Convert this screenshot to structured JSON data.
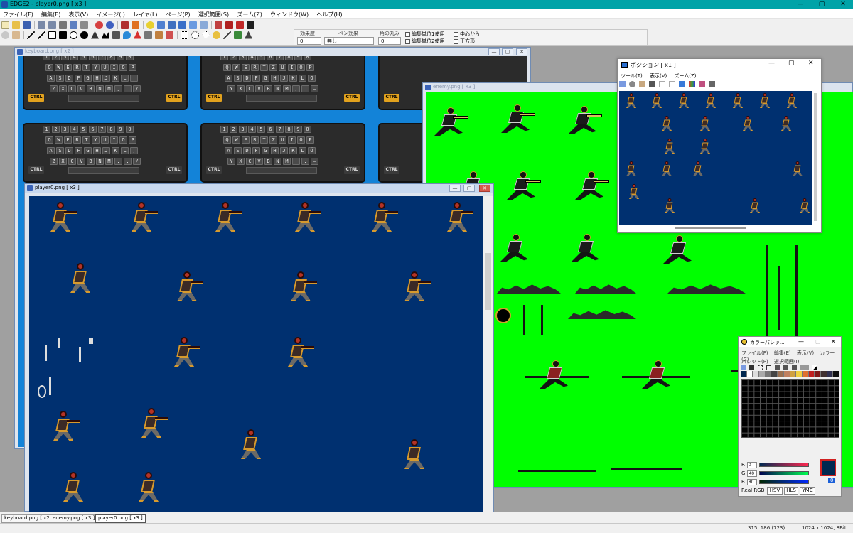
{
  "app": {
    "title": "EDGE2 - player0.png [ x3 ]",
    "window_controls": {
      "minimize": "—",
      "maximize": "▢",
      "close": "✕"
    }
  },
  "menubar": [
    "ファイル(F)",
    "編集(E)",
    "表示(V)",
    "イメージ(I)",
    "レイヤ(L)",
    "ページ(P)",
    "選択範囲(S)",
    "ズーム(Z)",
    "ウィンドウ(W)",
    "ヘルプ(H)"
  ],
  "options": {
    "effect_level_label": "効果度",
    "effect_level_value": "0",
    "pen_effect_label": "ペン効果",
    "pen_effect_value": "無し",
    "corner_round_label": "角の丸み",
    "corner_round_value": "0",
    "checks": [
      "編集単位1使用",
      "中心から",
      "編集単位2使用",
      "正方形"
    ]
  },
  "windows": {
    "keyboard": {
      "title": "keyboard.png [ x2 ]"
    },
    "enemy": {
      "title": "enemy.png [ x3 ]"
    },
    "player": {
      "title": "player0.png [ x3 ]"
    },
    "position": {
      "title": "ポジション [ x1 ]",
      "menu": [
        "ツール(T)",
        "表示(V)",
        "ズーム(Z)"
      ]
    },
    "palette": {
      "title": "カラーパレッ...",
      "menu_row1": [
        "ファイル(F)",
        "編集(E)",
        "表示(V)",
        "カラー(C)"
      ],
      "menu_row2": [
        "パレット(P)",
        "選択範囲(I)"
      ],
      "r_label": "R",
      "r_value": "0",
      "g_label": "G",
      "g_value": "40",
      "b_label": "B",
      "b_value": "80",
      "current_index": "0",
      "mode_label": "Real RGB",
      "buttons": [
        "HSV",
        "HLS",
        "YMC"
      ]
    }
  },
  "keyboard_rows": {
    "row_nums": [
      "1",
      "2",
      "3",
      "4",
      "5",
      "6",
      "7",
      "8",
      "9",
      "0"
    ],
    "row_q": [
      "Q",
      "W",
      "E",
      "R",
      "T",
      "Y",
      "U",
      "I",
      "O",
      "P"
    ],
    "row_a": [
      "A",
      "S",
      "D",
      "F",
      "G",
      "H",
      "J",
      "K",
      "L",
      ";"
    ],
    "row_z": [
      "Z",
      "X",
      "C",
      "V",
      "B",
      "N",
      "M",
      ",",
      ".",
      "/"
    ],
    "row_q_de": [
      "Q",
      "W",
      "E",
      "R",
      "T",
      "Z",
      "U",
      "I",
      "O",
      "P"
    ],
    "row_a_de": [
      "A",
      "S",
      "D",
      "F",
      "G",
      "H",
      "J",
      "K",
      "L",
      "Ö"
    ],
    "row_z_de": [
      "Y",
      "X",
      "C",
      "V",
      "B",
      "N",
      "M",
      ",",
      ".",
      "—"
    ],
    "ctrl": "CTRL"
  },
  "tabs": [
    "keyboard.png [ x2 ]",
    "enemy.png [ x3 ]",
    "player0.png [ x3 ]"
  ],
  "status": {
    "cursor": "315, 186 (723)",
    "image_info": "1024 x 1024, 8Bit"
  },
  "colors": {
    "app_caption": "#01a3a8",
    "player_canvas_bg": "#003070",
    "enemy_canvas_bg": "#00ff00",
    "keyboard_canvas_bg": "#1383d8",
    "selected_color": "#002850"
  }
}
